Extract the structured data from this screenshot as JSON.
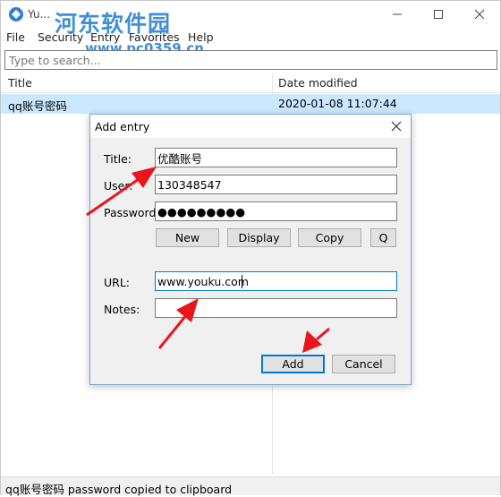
{
  "window": {
    "title": "Yu...",
    "watermark_text": "河东软件园",
    "watermark_url": "www.pc0359.cn"
  },
  "menu": {
    "items": [
      "File",
      "Security",
      "Entry",
      "Favorites",
      "Help"
    ]
  },
  "search": {
    "placeholder": "Type to search..."
  },
  "table": {
    "columns": [
      "Title",
      "Date modified"
    ],
    "rows": [
      {
        "title": "qq账号密码",
        "date": "2020-01-08 11:07:44"
      }
    ]
  },
  "dialog": {
    "title": "Add entry",
    "labels": {
      "title": "Title:",
      "user": "User:",
      "password": "Password",
      "url": "URL:",
      "notes": "Notes:"
    },
    "values": {
      "title": "优酷账号",
      "user": "130348547",
      "password": "●●●●●●●●●",
      "url": "www.youku.com",
      "notes": ""
    },
    "buttons": {
      "new": "New",
      "display": "Display",
      "copy": "Copy",
      "q": "Q",
      "add": "Add",
      "cancel": "Cancel"
    }
  },
  "status": {
    "text": "qq账号密码 password copied to clipboard"
  },
  "colors": {
    "selection": "#cce8ff",
    "accent": "#0078d7",
    "arrow": "#e8151b",
    "watermark": "#3f8fd8"
  }
}
